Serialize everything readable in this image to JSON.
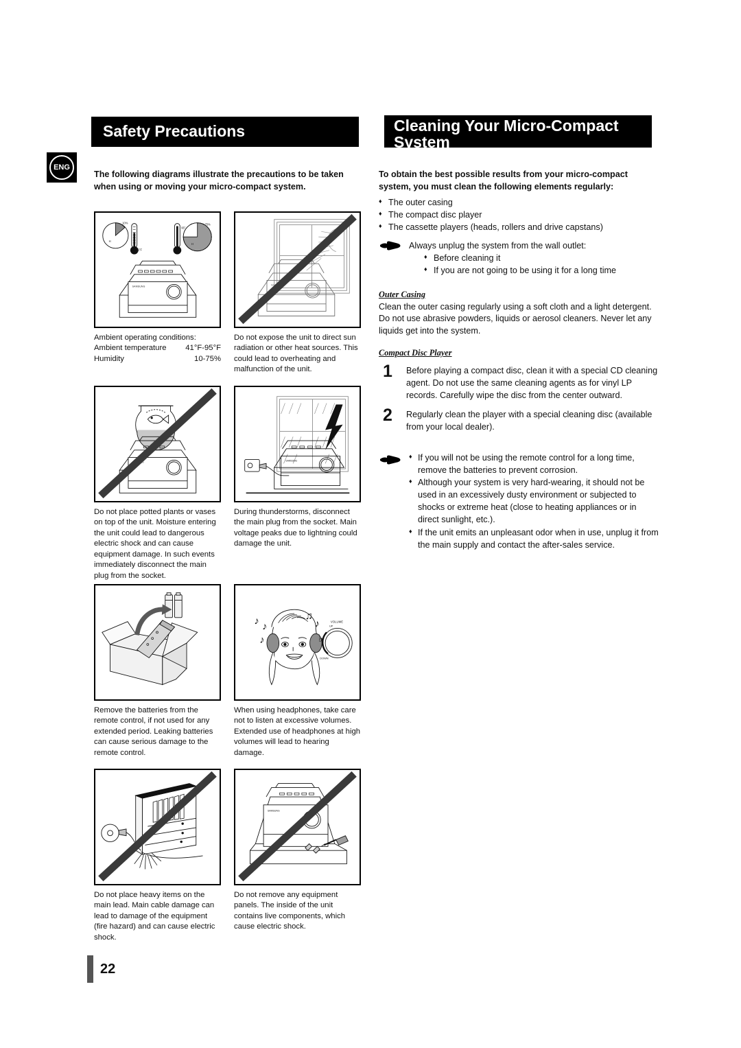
{
  "language_badge": "ENG",
  "page_number": "22",
  "left": {
    "banner_title": "Safety Precautions",
    "lead": "The following diagrams illustrate the precautions to be taken when using or moving your micro-compact system.",
    "figures": [
      {
        "name": "ambient-conditions",
        "caption_lines": [
          "Ambient operating conditions:",
          "Ambient temperature",
          "Humidity"
        ],
        "caption_values": [
          "",
          "41°F-95°F",
          "10-75%"
        ],
        "labels": {
          "pie_left": "10%",
          "pie_left_h": "H",
          "therm_left": "5°F",
          "therm_right": "95°",
          "pie_right": "75%",
          "pie_right_h": "H"
        }
      },
      {
        "name": "direct-sunlight",
        "caption": "Do not expose the unit to direct sun radiation or other heat sources. This could lead to overheating and malfunction of the unit."
      },
      {
        "name": "potted-plants-vases",
        "caption": "Do not place potted plants or vases on top of the unit. Moisture entering the unit could lead to dangerous electric shock and can cause equipment damage. In such events immediately disconnect the main plug from the socket."
      },
      {
        "name": "thunderstorm-unplug",
        "caption": "During thunderstorms, disconnect the main plug from the socket. Main voltage peaks due to lightning could damage the unit."
      },
      {
        "name": "remove-batteries",
        "caption": "Remove the batteries from the remote control, if not used for any extended period. Leaking batteries can cause serious damage to the remote control."
      },
      {
        "name": "headphone-volume",
        "caption": "When using headphones, take care not to listen at excessive volumes. Extended use of headphones at high volumes will lead to hearing damage.",
        "labels": {
          "volume": "VOLUME",
          "up": "UP",
          "down": "DOWN"
        }
      },
      {
        "name": "heavy-items-on-lead",
        "caption": "Do not place heavy items on the main lead. Main cable damage can lead to damage of the equipment (fire hazard) and can cause electric shock."
      },
      {
        "name": "do-not-remove-panels",
        "caption": "Do not remove any equipment panels. The inside of the unit contains live components, which cause electric shock."
      }
    ]
  },
  "right": {
    "banner_title": "Cleaning Your Micro-Compact System",
    "lead": "To obtain the best possible results from your micro-compact system, you must clean the following elements regularly:",
    "elements": [
      "The outer casing",
      "The compact disc player",
      "The cassette players (heads, rollers and drive capstans)"
    ],
    "unplug_note": {
      "title": "Always unplug the system from the wall outlet:",
      "items": [
        "Before cleaning it",
        "If you are not going to be using it for a long time"
      ]
    },
    "outer_casing": {
      "heading": "Outer Casing",
      "text": "Clean the outer casing regularly using a soft cloth and a light detergent. Do not use abrasive powders, liquids or aerosol cleaners. Never let any liquids get into the system."
    },
    "compact_disc_player": {
      "heading": "Compact Disc Player",
      "steps": [
        {
          "num": "1",
          "text": "Before playing a compact disc, clean it with a special CD cleaning agent. Do not use the same cleaning agents as for vinyl LP records. Carefully wipe the disc from the center outward."
        },
        {
          "num": "2",
          "text": "Regularly clean the player with a special cleaning disc (available from your local dealer)."
        }
      ]
    },
    "final_notes": [
      "If you will not be using the remote control for a long time, remove the batteries to prevent corrosion.",
      "Although your system is very hard-wearing, it should not be used in an excessively dusty environment or subjected to shocks or extreme heat (close to heating appliances or in direct sunlight, etc.).",
      "If the unit emits an unpleasant odor when in use, unplug it from the main supply and contact the after-sales service."
    ]
  },
  "brand_label": "SAMSUNG"
}
